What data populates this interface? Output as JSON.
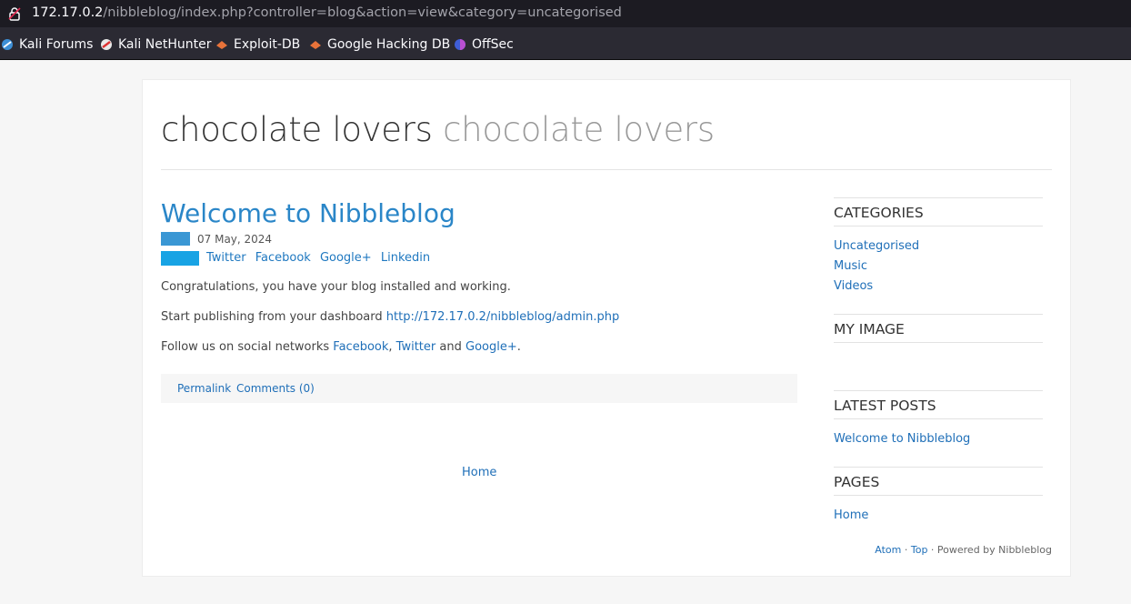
{
  "browser": {
    "url_host": "172.17.0.2",
    "url_path": "/nibbleblog/index.php?controller=blog&action=view&category=uncategorised",
    "bookmarks": [
      "Kali Forums",
      "Kali NetHunter",
      "Exploit-DB",
      "Google Hacking DB",
      "OffSec"
    ]
  },
  "site": {
    "name": "chocolate lovers",
    "slogan": "chocolate lovers"
  },
  "post": {
    "title": "Welcome to Nibbleblog",
    "date": "07 May, 2024",
    "share": [
      "Twitter",
      "Facebook",
      "Google+",
      "Linkedin"
    ],
    "p1": "Congratulations, you have your blog installed and working.",
    "p2_text": "Start publishing from your dashboard",
    "p2_link": "http://172.17.0.2/nibbleblog/admin.php",
    "p3_text": "Follow us on social networks",
    "p3_link1": "Facebook",
    "p3_sep": ",",
    "p3_link2": "Twitter",
    "p3_and": "and",
    "p3_link3": "Google+",
    "p3_end": ".",
    "permalink": "Permalink",
    "comments": "Comments (0)"
  },
  "pager": {
    "home": "Home"
  },
  "sidebar": {
    "categories_title": "CATEGORIES",
    "categories": [
      "Uncategorised",
      "Music",
      "Videos"
    ],
    "image_title": "MY IMAGE",
    "latest_title": "LATEST POSTS",
    "latest": [
      "Welcome to Nibbleblog"
    ],
    "pages_title": "PAGES",
    "pages": [
      "Home"
    ]
  },
  "footer": {
    "atom": "Atom",
    "sep1": " · ",
    "top": "Top",
    "powered": " · Powered by Nibbleblog"
  }
}
